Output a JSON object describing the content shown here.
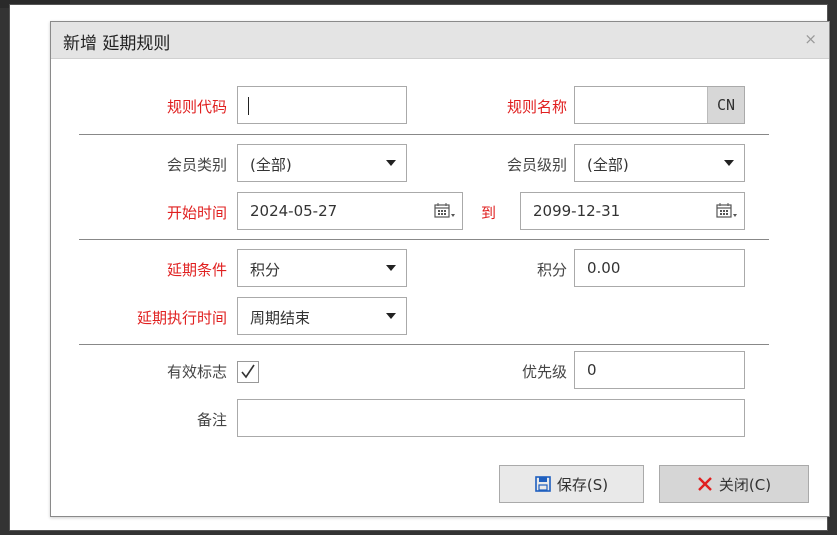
{
  "dialog": {
    "title": "新增 延期规则",
    "close_glyph": "×"
  },
  "form": {
    "rule_code_label": "规则代码",
    "rule_code_value": "",
    "rule_name_label": "规则名称",
    "rule_name_value": "",
    "cn_button": "CN",
    "member_type_label": "会员类别",
    "member_type_value": "(全部)",
    "member_level_label": "会员级别",
    "member_level_value": "(全部)",
    "start_time_label": "开始时间",
    "start_time_value": "2024-05-27",
    "to_label": "到",
    "end_time_value": "2099-12-31",
    "extend_condition_label": "延期条件",
    "extend_condition_value": "积分",
    "points_label": "积分",
    "points_value": "0.00",
    "extend_exec_label": "延期执行时间",
    "extend_exec_value": "周期结束",
    "valid_flag_label": "有效标志",
    "valid_flag_checked": true,
    "priority_label": "优先级",
    "priority_value": "0",
    "remark_label": "备注",
    "remark_value": ""
  },
  "buttons": {
    "save_label": "保存(S)",
    "close_label": "关闭(C)"
  },
  "colors": {
    "required": "#e02020",
    "save_icon": "#1f5fbf",
    "close_icon": "#e02020"
  },
  "icons": {
    "save": "floppy-disk-icon",
    "close": "x-icon",
    "calendar": "calendar-icon",
    "dropdown": "chevron-down-icon",
    "checkbox": "checkmark-icon"
  }
}
